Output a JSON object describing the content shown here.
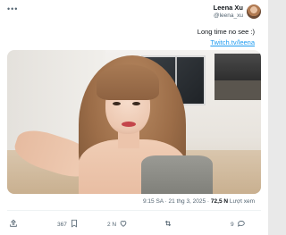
{
  "author": {
    "display_name": "Leena Xu",
    "handle": "@leena_xu"
  },
  "tweet": {
    "text": "Long time no see :)",
    "link": "Twitch.tv/leena"
  },
  "meta": {
    "time_date": "9:15 SA · 21 thg 3, 2025 · ",
    "views_count": "72,5 N",
    "views_label": " Lượt xem"
  },
  "actions": {
    "reply_count": "9",
    "retweet_count": "",
    "like_count": "2 N",
    "bookmark_count": "367",
    "share_count": ""
  },
  "icons": {
    "more": "more-dots-icon",
    "reply": "reply-icon",
    "retweet": "retweet-icon",
    "like": "heart-icon",
    "bookmark": "bookmark-icon",
    "share": "share-icon"
  },
  "colors": {
    "link": "#1d9bf0",
    "text": "#0f1419",
    "muted": "#536471"
  }
}
